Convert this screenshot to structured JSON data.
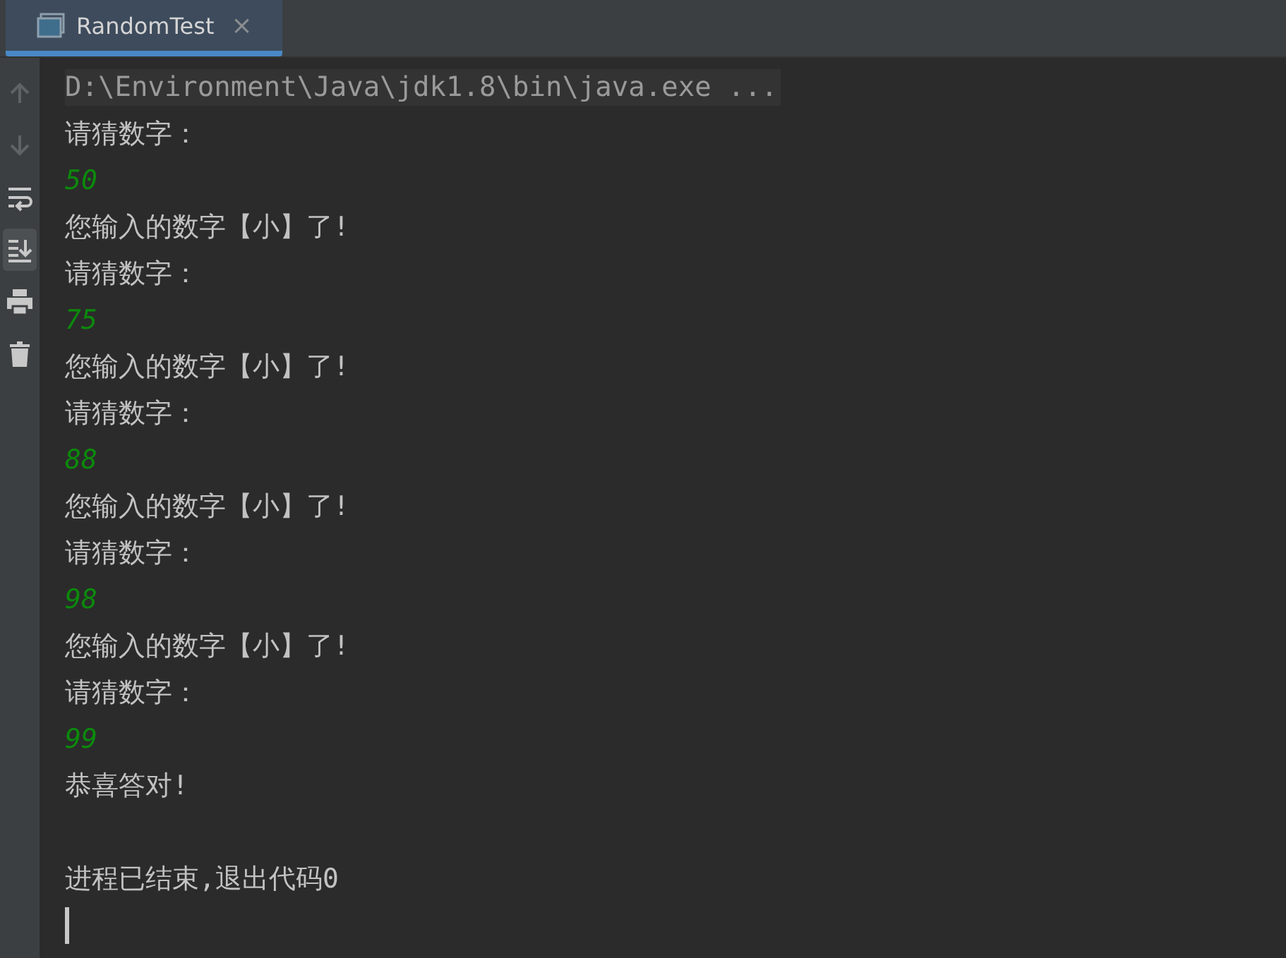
{
  "tab": {
    "title": "RandomTest",
    "selected": true,
    "close": "×"
  },
  "toolbar": [
    {
      "kind": "up",
      "disabled": true,
      "on": false
    },
    {
      "kind": "down",
      "disabled": true,
      "on": false
    },
    {
      "kind": "wrap",
      "disabled": false,
      "on": false
    },
    {
      "kind": "scroll-end",
      "disabled": false,
      "on": true
    },
    {
      "kind": "print",
      "disabled": false,
      "on": false
    },
    {
      "kind": "trash",
      "disabled": false,
      "on": false
    }
  ],
  "console": [
    {
      "kind": "command",
      "text": "D:\\Environment\\Java\\jdk1.8\\bin\\java.exe ..."
    },
    {
      "kind": "output",
      "text": "请猜数字："
    },
    {
      "kind": "input",
      "text": "50"
    },
    {
      "kind": "output",
      "text": "您输入的数字【小】了!"
    },
    {
      "kind": "output",
      "text": "请猜数字："
    },
    {
      "kind": "input",
      "text": "75"
    },
    {
      "kind": "output",
      "text": "您输入的数字【小】了!"
    },
    {
      "kind": "output",
      "text": "请猜数字："
    },
    {
      "kind": "input",
      "text": "88"
    },
    {
      "kind": "output",
      "text": "您输入的数字【小】了!"
    },
    {
      "kind": "output",
      "text": "请猜数字："
    },
    {
      "kind": "input",
      "text": "98"
    },
    {
      "kind": "output",
      "text": "您输入的数字【小】了!"
    },
    {
      "kind": "output",
      "text": "请猜数字："
    },
    {
      "kind": "input",
      "text": "99"
    },
    {
      "kind": "output",
      "text": "恭喜答对!"
    },
    {
      "kind": "blank"
    },
    {
      "kind": "output",
      "text": "进程已结束,退出代码0"
    },
    {
      "kind": "cursor"
    }
  ]
}
